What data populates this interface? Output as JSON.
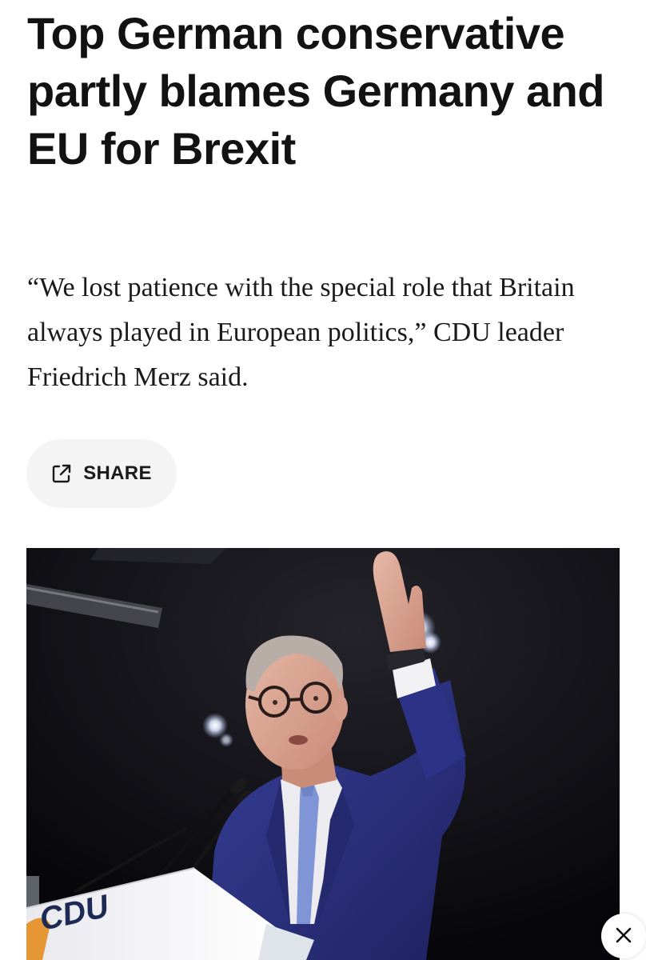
{
  "article": {
    "headline": "Top German conservative partly blames Germany and EU for Brexit",
    "dek": "“We lost patience with the special role that Britain always played in European politics,” CDU leader Friedrich Merz said.",
    "share_label": "SHARE",
    "share_icon": "external-share-icon",
    "photo": {
      "podium_text": "CDU"
    },
    "close_icon": "close-x-icon"
  },
  "colors": {
    "text": "#121212",
    "share_bg": "#f4f4f4",
    "suit": "#2b2f7a",
    "tie": "#7f95d6",
    "photo_bg": "#0b0b10"
  }
}
